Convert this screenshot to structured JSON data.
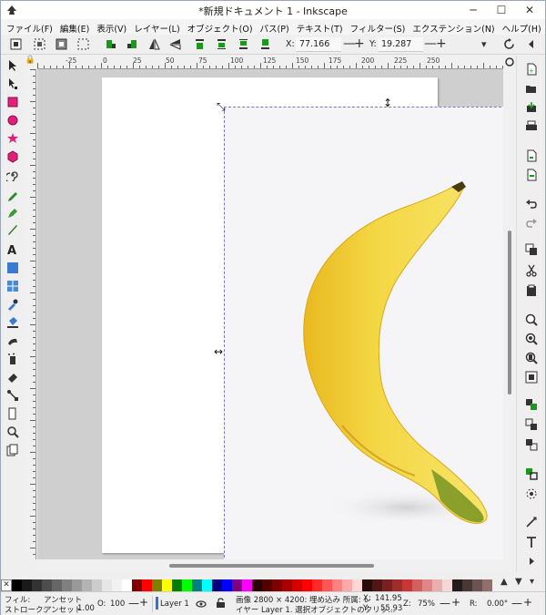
{
  "window": {
    "title": "*新規ドキュメント 1 - Inkscape",
    "minimize": "─",
    "maximize": "☐",
    "close": "✕"
  },
  "menu": [
    "ファイル(F)",
    "編集(E)",
    "表示(V)",
    "レイヤー(L)",
    "オブジェクト(O)",
    "パス(P)",
    "テキスト(T)",
    "フィルター(S)",
    "エクステンション(N)",
    "ヘルプ(H)"
  ],
  "controls": {
    "x_label": "X:",
    "x_value": "77.166",
    "y_label": "Y:",
    "y_value": "19.287",
    "minus": "—",
    "plus": "+",
    "dropdown": "▾"
  },
  "ruler": {
    "top_labels": [
      "-25",
      "0",
      "25",
      "50",
      "75",
      "100",
      "125",
      "150",
      "175",
      "200",
      "225",
      "250"
    ],
    "left_labels": [
      "50",
      "75",
      "100",
      "125",
      "150",
      "175",
      "200",
      "225",
      "250",
      "275"
    ]
  },
  "palette": {
    "none_symbol": "✕",
    "colors": [
      "#000000",
      "#1a1a1a",
      "#333333",
      "#4d4d4d",
      "#666666",
      "#808080",
      "#999999",
      "#b3b3b3",
      "#cccccc",
      "#e6e6e6",
      "#f2f2f2",
      "#ffffff",
      "#800000",
      "#ff0000",
      "#808000",
      "#ffff00",
      "#008000",
      "#00ff00",
      "#008080",
      "#00ffff",
      "#000080",
      "#0000ff",
      "#800080",
      "#ff00ff",
      "#2b0000",
      "#550000",
      "#800000",
      "#aa0000",
      "#d40000",
      "#ff0000",
      "#ff2a2a",
      "#ff5555",
      "#ff8080",
      "#ffaaaa",
      "#ffd5d5",
      "#280b0b",
      "#501616",
      "#782121",
      "#a02c2c",
      "#c83737",
      "#d35f5f",
      "#de8787",
      "#e9afaf",
      "#f4d7d7",
      "#241c1c",
      "#483737",
      "#6c5353",
      "#916f6f"
    ],
    "btn_up": "▲",
    "btn_down": "▼",
    "btn_menu": "▾"
  },
  "status": {
    "fill_label": "フィル:",
    "stroke_label": "ストローク:",
    "fill_value": "アンセット",
    "stroke_value": "アンセット",
    "stroke_width": "1.00",
    "opacity_label": "O:",
    "opacity_value": "100",
    "layer": "Layer 1",
    "message_line1": "画像 2800 × 4200: 埋め込み 所属: レ",
    "message_line2": "イヤー Layer 1. 選択オブジェクトのクリッ...",
    "cursor_x_label": "X:",
    "cursor_x": "141.95",
    "cursor_y_label": "Y:",
    "cursor_y": "55.93",
    "zoom_label": "Z:",
    "zoom": "75%",
    "rotate_label": "R:",
    "rotate": "0.00°"
  }
}
